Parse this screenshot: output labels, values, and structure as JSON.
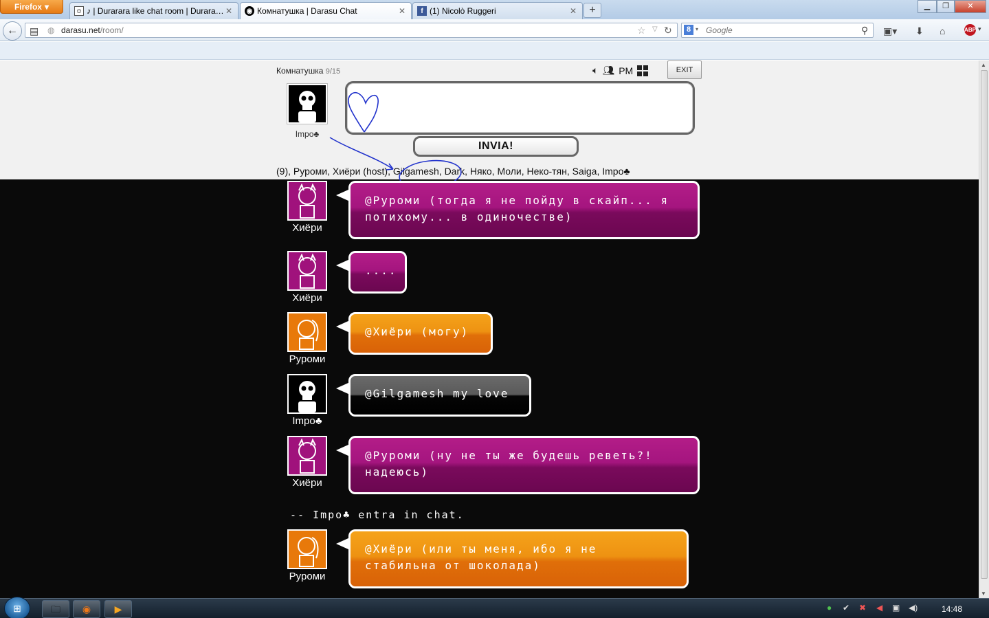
{
  "browser": {
    "menu_button": "Firefox",
    "tabs": [
      {
        "label": "♪ | Durarara like chat room | Durarara ...",
        "active": false
      },
      {
        "label": "Комнатушка | Darasu Chat",
        "active": true
      },
      {
        "label": "(1) Nicolò Ruggeri",
        "active": false
      }
    ],
    "url_host": "darasu.net",
    "url_path": "/room/",
    "search_placeholder": "Google"
  },
  "room": {
    "name": "Комнатушка",
    "count": "9/15",
    "pm_label": "PM",
    "exit_label": "EXIT",
    "my_name": "Impo♣",
    "send_label": "INVIA!",
    "userlist": "(9), Руроми, Хиёри (host), Gilgamesh, Dark, Няко, Моли, Неко-тян, Saiga, Impo♣"
  },
  "messages": [
    {
      "user": "Хиёри",
      "avatar": "pink",
      "text": "@Руроми (тогда я не пойду в скайп... я\nпотихому... в одиночестве)"
    },
    {
      "user": "Хиёри",
      "avatar": "pink",
      "text": "...."
    },
    {
      "user": "Руроми",
      "avatar": "orange",
      "text": "@Хиёри (могу)"
    },
    {
      "user": "Impo♣",
      "avatar": "black",
      "text": "@Gilgamesh my love"
    },
    {
      "user": "Хиёри",
      "avatar": "pink",
      "text": "@Руроми (ну не ты же будешь реветь?!\nнадеюсь)"
    },
    {
      "notice": "-- Impo♣ entra in chat."
    },
    {
      "user": "Руроми",
      "avatar": "orange",
      "text": "@Хиёри (или ты меня, ибо я не\nстабильна от шоколада)"
    }
  ],
  "taskbar": {
    "clock": "14:48"
  },
  "colors": {
    "pink": "#a0127c",
    "orange": "#e8790a",
    "black": "#000000",
    "scribble": "#2233cc"
  }
}
